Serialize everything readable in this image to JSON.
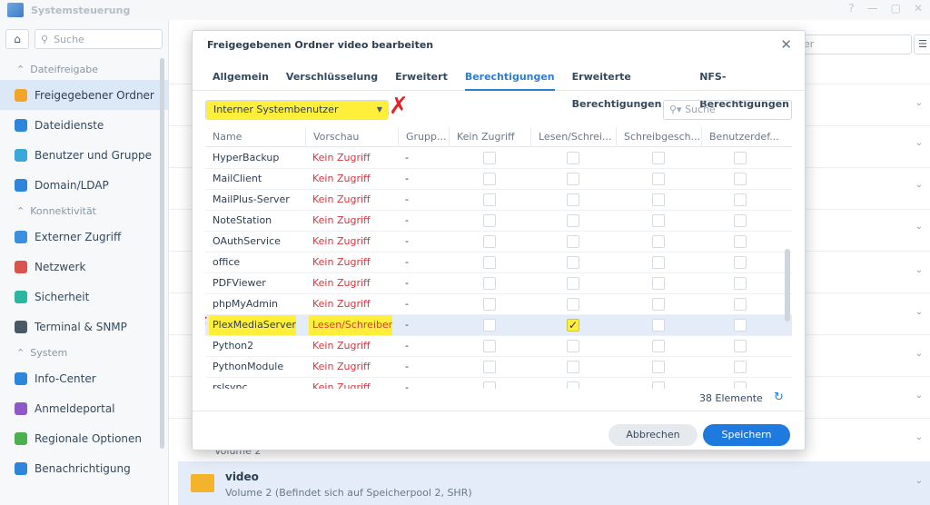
{
  "window": {
    "title": "Systemsteuerung"
  },
  "sidebar": {
    "search_placeholder": "Suche",
    "sections": [
      {
        "label": "Dateifreigabe",
        "items": [
          {
            "label": "Freigegebener Ordner",
            "icon": "shared-folder-icon",
            "active": true
          },
          {
            "label": "Dateidienste",
            "icon": "file-services-icon"
          },
          {
            "label": "Benutzer und Gruppe",
            "icon": "users-icon"
          },
          {
            "label": "Domain/LDAP",
            "icon": "domain-icon"
          }
        ]
      },
      {
        "label": "Konnektivität",
        "items": [
          {
            "label": "Externer Zugriff",
            "icon": "external-access-icon"
          },
          {
            "label": "Netzwerk",
            "icon": "network-icon"
          },
          {
            "label": "Sicherheit",
            "icon": "shield-icon"
          },
          {
            "label": "Terminal & SNMP",
            "icon": "terminal-icon"
          }
        ]
      },
      {
        "label": "System",
        "items": [
          {
            "label": "Info-Center",
            "icon": "info-icon"
          },
          {
            "label": "Anmeldeportal",
            "icon": "login-portal-icon"
          },
          {
            "label": "Regionale Optionen",
            "icon": "regional-icon"
          },
          {
            "label": "Benachrichtigung",
            "icon": "notification-icon"
          }
        ]
      }
    ]
  },
  "main": {
    "search_partial": "er",
    "volume_partial": "Volume 2",
    "video_row": {
      "name": "video",
      "desc": "Volume 2 (Befindet sich auf Speicherpool 2, SHR)"
    }
  },
  "dialog": {
    "title": "Freigegebenen Ordner video bearbeiten",
    "tabs": [
      "Allgemein",
      "Verschlüsselung",
      "Erweitert",
      "Berechtigungen",
      "Erweiterte Berechtigungen",
      "NFS-Berechtigungen"
    ],
    "active_tab": "Berechtigungen",
    "user_type": "Interner Systembenutzer",
    "search_placeholder": "Suche",
    "columns": [
      "Name",
      "Vorschau",
      "Grupp...",
      "Kein Zugriff",
      "Lesen/Schrei...",
      "Schreibgesch...",
      "Benutzerdef..."
    ],
    "rows": [
      {
        "name": "HyperBackup",
        "preview": "Kein Zugriff",
        "group": "-",
        "checked": ""
      },
      {
        "name": "MailClient",
        "preview": "Kein Zugriff",
        "group": "-",
        "checked": ""
      },
      {
        "name": "MailPlus-Server",
        "preview": "Kein Zugriff",
        "group": "-",
        "checked": ""
      },
      {
        "name": "NoteStation",
        "preview": "Kein Zugriff",
        "group": "-",
        "checked": ""
      },
      {
        "name": "OAuthService",
        "preview": "Kein Zugriff",
        "group": "-",
        "checked": ""
      },
      {
        "name": "office",
        "preview": "Kein Zugriff",
        "group": "-",
        "checked": ""
      },
      {
        "name": "PDFViewer",
        "preview": "Kein Zugriff",
        "group": "-",
        "checked": ""
      },
      {
        "name": "phpMyAdmin",
        "preview": "Kein Zugriff",
        "group": "-",
        "checked": ""
      },
      {
        "name": "PlexMediaServer",
        "preview": "Lesen/Schreiben",
        "group": "-",
        "checked": "rw",
        "selected": true
      },
      {
        "name": "Python2",
        "preview": "Kein Zugriff",
        "group": "-",
        "checked": ""
      },
      {
        "name": "PythonModule",
        "preview": "Kein Zugriff",
        "group": "-",
        "checked": ""
      },
      {
        "name": "rslsync",
        "preview": "Kein Zugriff",
        "group": "-",
        "checked": ""
      }
    ],
    "count": "38 Elemente",
    "cancel_label": "Abbrechen",
    "save_label": "Speichern"
  },
  "colors": {
    "accent": "#1f7ae0",
    "highlight": "#ffef3a",
    "no_access": "#d9363e"
  }
}
